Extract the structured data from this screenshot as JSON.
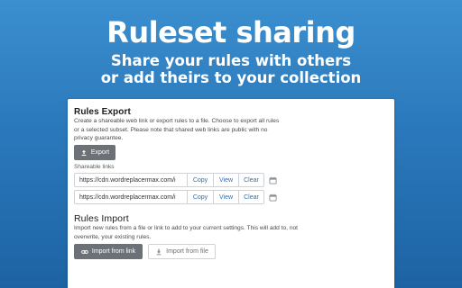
{
  "hero": {
    "title": "Ruleset sharing",
    "subtitle_line1": "Share your rules with others",
    "subtitle_line2": "or add theirs to your collection"
  },
  "export": {
    "title": "Rules Export",
    "description": "Create a shareable web link or export rules to a file. Choose to export all rules or a selected subset. Please note that shared web links are public with no privacy guarantee.",
    "button_label": "Export",
    "links_label": "Shareable links",
    "links": [
      {
        "url": "https://cdn.wordreplacermax.com/i",
        "copy": "Copy",
        "view": "View",
        "clear": "Clear"
      },
      {
        "url": "https://cdn.wordreplacermax.com/i",
        "copy": "Copy",
        "view": "View",
        "clear": "Clear"
      }
    ]
  },
  "import": {
    "title": "Rules Import",
    "description": "Import new rules from a file or link to add to your current settings. This will add to, not overwrite, your existing rules.",
    "link_button_label": "Import from link",
    "file_button_label": "Import from file"
  },
  "icons": {
    "export": "upload-icon",
    "import_link": "link-icon",
    "import_file": "download-icon",
    "expiry": "calendar-icon"
  },
  "colors": {
    "background_top": "#3b8fcf",
    "background_bottom": "#1d63a3",
    "button_dark": "#6b7177",
    "link_accent": "#2f6fb0"
  }
}
